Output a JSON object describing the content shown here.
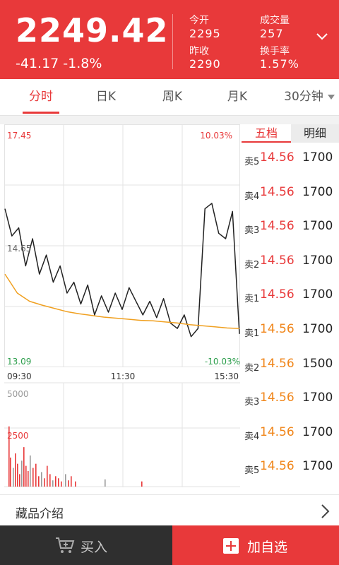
{
  "header": {
    "price": "2249.42",
    "change": "-41.17 -1.8%",
    "stats": [
      {
        "label": "今开",
        "value": "2295"
      },
      {
        "label": "昨收",
        "value": "2290"
      },
      {
        "label": "成交量",
        "value": "257"
      },
      {
        "label": "换手率",
        "value": "1.57%"
      }
    ]
  },
  "tabs": [
    {
      "label": "分时",
      "active": true
    },
    {
      "label": "日K"
    },
    {
      "label": "周K"
    },
    {
      "label": "月K"
    },
    {
      "label": "30分钟"
    }
  ],
  "chart": {
    "max_price": "17.45",
    "max_pct": "10.03%",
    "mid_price": "14.65",
    "min_price": "13.09",
    "min_pct": "-10.03%",
    "times": [
      "09:30",
      "11:30",
      "15:30"
    ],
    "vol_max": "5000",
    "vol_mid": "2500"
  },
  "chart_data": {
    "type": "line",
    "xlabel": "",
    "ylabel": "",
    "ylim": [
      13.09,
      17.45
    ],
    "x": [
      "09:30",
      "11:30",
      "15:30"
    ],
    "series": [
      {
        "values": [
          15.95,
          15.45,
          15.6,
          14.9,
          15.4,
          14.75,
          15.1,
          14.6,
          14.9,
          14.4,
          14.6,
          14.2,
          14.55,
          14.0,
          14.35,
          14.05,
          14.4,
          14.1,
          14.5,
          14.25,
          14.0,
          14.25,
          13.95,
          14.3,
          13.85,
          13.75,
          14.0,
          13.6,
          13.75,
          15.95,
          16.05,
          15.5,
          15.4,
          15.9,
          13.65
        ]
      },
      {
        "values": [
          14.75,
          14.4,
          14.25,
          14.18,
          14.12,
          14.06,
          14.02,
          13.99,
          13.96,
          13.94,
          13.92,
          13.9,
          13.89,
          13.87,
          13.85,
          13.82,
          13.8,
          13.78,
          13.76,
          13.75
        ]
      }
    ],
    "volume": {
      "ylim": [
        0,
        5000
      ]
    }
  },
  "orderbook": {
    "tabs": [
      "五档",
      "明细"
    ],
    "rows": [
      {
        "label": "卖5",
        "price": "14.56",
        "qty": "1700",
        "color": "#e8393a"
      },
      {
        "label": "卖4",
        "price": "14.56",
        "qty": "1700",
        "color": "#e8393a"
      },
      {
        "label": "卖3",
        "price": "14.56",
        "qty": "1700",
        "color": "#e8393a"
      },
      {
        "label": "卖2",
        "price": "14.56",
        "qty": "1700",
        "color": "#e8393a"
      },
      {
        "label": "卖1",
        "price": "14.56",
        "qty": "1700",
        "color": "#e8393a"
      },
      {
        "label": "卖1",
        "price": "14.56",
        "qty": "1700",
        "color": "#f08519"
      },
      {
        "label": "卖2",
        "price": "14.56",
        "qty": "1500",
        "color": "#f08519"
      },
      {
        "label": "卖3",
        "price": "14.56",
        "qty": "1700",
        "color": "#f08519"
      },
      {
        "label": "卖4",
        "price": "14.56",
        "qty": "1700",
        "color": "#f08519"
      },
      {
        "label": "卖5",
        "price": "14.56",
        "qty": "1700",
        "color": "#f08519"
      }
    ]
  },
  "intro": {
    "label": "藏品介绍"
  },
  "footer": {
    "buy": "买入",
    "add": "加自选"
  },
  "colors": {
    "brand": "#e8393a",
    "avg_line": "#f0a020",
    "down": "#2a9d4a",
    "footer_dark": "#2f2f2f"
  }
}
